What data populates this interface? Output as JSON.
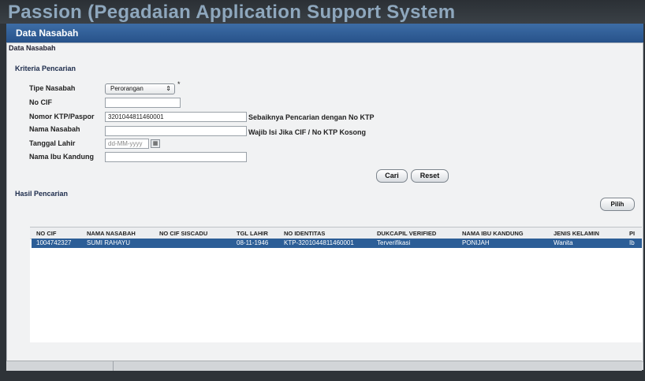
{
  "app": {
    "title": "Passion (Pegadaian Application Support System"
  },
  "window": {
    "title": "Data Nasabah"
  },
  "panel": {
    "title": "Data Nasabah"
  },
  "criteria": {
    "section_title": "Kriteria Pencarian",
    "labels": {
      "tipe": "Tipe Nasabah",
      "cif": "No CIF",
      "ktp": "Nomor KTP/Paspor",
      "nama": "Nama Nasabah",
      "tgl": "Tanggal Lahir",
      "ibu": "Nama Ibu Kandung"
    },
    "tipe_value": "Perorangan",
    "required_mark": "*",
    "ktp_value": "3201044811460001",
    "date_placeholder": "dd-MM-yyyy",
    "note_ktp": "Sebaiknya Pencarian dengan No KTP",
    "note_nama": "Wajib Isi Jika CIF / No KTP Kosong",
    "cari_label": "Cari",
    "reset_label": "Reset"
  },
  "results": {
    "section_title": "Hasil Pencarian",
    "pilih_label": "Pilih",
    "columns": [
      "NO CIF",
      "NAMA NASABAH",
      "NO CIF SISCADU",
      "TGL LAHIR",
      "NO IDENTITAS",
      "DUKCAPIL VERIFIED",
      "NAMA IBU KANDUNG",
      "JENIS KELAMIN",
      "PI"
    ],
    "rows": [
      [
        "1004742327",
        "SUMI RAHAYU",
        "",
        "08-11-1946",
        "KTP-3201044811460001",
        "Terverifikasi",
        "PONIJAH",
        "Wanita",
        "Ib"
      ]
    ]
  }
}
